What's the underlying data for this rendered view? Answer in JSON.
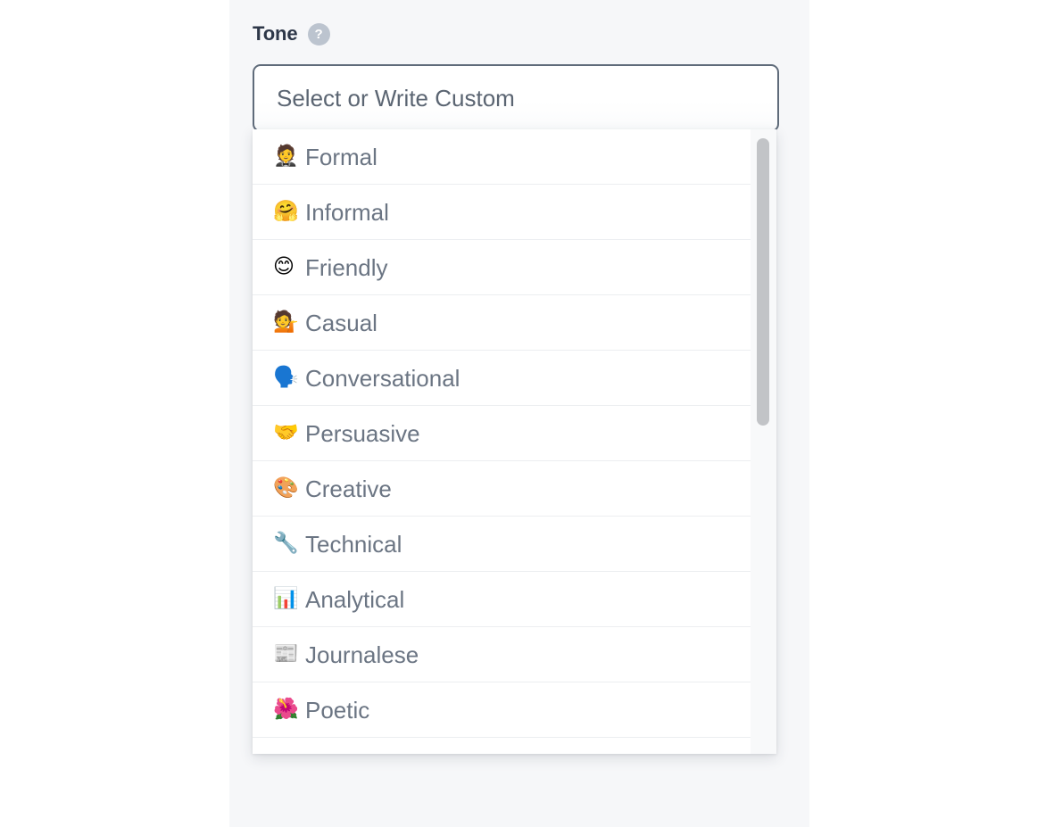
{
  "field": {
    "label": "Tone",
    "help_icon": "question-mark-icon",
    "help_glyph": "?",
    "input_placeholder": "Select or Write Custom",
    "input_value": ""
  },
  "dropdown": {
    "open": true,
    "options": [
      {
        "emoji": "🤵",
        "icon_name": "person-in-tuxedo-emoji",
        "label": "Formal"
      },
      {
        "emoji": "🤗",
        "icon_name": "hugging-face-emoji",
        "label": "Informal"
      },
      {
        "emoji": "😊",
        "icon_name": "smiling-face-emoji",
        "label": "Friendly"
      },
      {
        "emoji": "💁",
        "icon_name": "person-tipping-hand-emoji",
        "label": "Casual"
      },
      {
        "emoji": "🗣️",
        "icon_name": "speaking-head-emoji",
        "label": "Conversational"
      },
      {
        "emoji": "🤝",
        "icon_name": "handshake-emoji",
        "label": "Persuasive"
      },
      {
        "emoji": "🎨",
        "icon_name": "artist-palette-emoji",
        "label": "Creative"
      },
      {
        "emoji": "🔧",
        "icon_name": "wrench-emoji",
        "label": "Technical"
      },
      {
        "emoji": "📊",
        "icon_name": "bar-chart-emoji",
        "label": "Analytical"
      },
      {
        "emoji": "📰",
        "icon_name": "newspaper-emoji",
        "label": "Journalese"
      },
      {
        "emoji": "🌺",
        "icon_name": "hibiscus-emoji",
        "label": "Poetic"
      }
    ],
    "scrollbar": {
      "visible": true,
      "thumb_top_pct": 1.4,
      "thumb_height_pct": 46
    }
  },
  "colors": {
    "page_background": "#ffffff",
    "panel_background": "#f6f7f9",
    "input_border": "#5f6b7a",
    "label_text": "#2d3748",
    "option_text": "#6b7583",
    "placeholder_text": "#5b6572",
    "separator": "#eceef1",
    "help_icon_background": "#bcc4cf",
    "scroll_thumb": "#c2c4c7",
    "scroll_track": "#f8f9fa"
  }
}
